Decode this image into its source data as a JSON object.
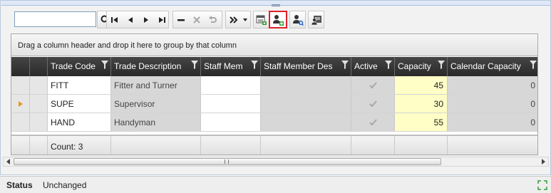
{
  "toolbar": {
    "search_value": "",
    "icons": [
      "search-icon",
      "first-record-icon",
      "previous-record-icon",
      "next-record-icon",
      "last-record-icon",
      "remove-icon",
      "cancel-icon",
      "undo-icon",
      "more-commands-icon",
      "dropdown-icon",
      "export-icon",
      "add-user-icon",
      "find-user-icon",
      "user-card-icon"
    ]
  },
  "grid": {
    "group_hint": "Drag a column header and drop it here to group by that column",
    "columns": [
      {
        "label": "Trade Code"
      },
      {
        "label": "Trade Description"
      },
      {
        "label": "Staff Mem"
      },
      {
        "label": "Staff Member Des"
      },
      {
        "label": "Active"
      },
      {
        "label": "Capacity"
      },
      {
        "label": "Calendar Capacity"
      }
    ],
    "rows": [
      {
        "trade_code": "FITT",
        "trade_description": "Fitter and Turner",
        "staff_member": "",
        "staff_member_description": "",
        "active": true,
        "capacity": "45",
        "calendar_capacity": "0",
        "current": false
      },
      {
        "trade_code": "SUPE",
        "trade_description": "Supervisor",
        "staff_member": "",
        "staff_member_description": "",
        "active": true,
        "capacity": "30",
        "calendar_capacity": "0",
        "current": true
      },
      {
        "trade_code": "HAND",
        "trade_description": "Handyman",
        "staff_member": "",
        "staff_member_description": "",
        "active": true,
        "capacity": "55",
        "calendar_capacity": "0",
        "current": false
      }
    ],
    "footer": {
      "count": "Count: 3"
    }
  },
  "status": {
    "label": "Status",
    "value": "Unchanged"
  },
  "colors": {
    "header_bg": "#333333",
    "capacity_bg": "#fefec6",
    "readonly_bg": "#d7d7d7",
    "highlight_border": "#e0202a"
  }
}
